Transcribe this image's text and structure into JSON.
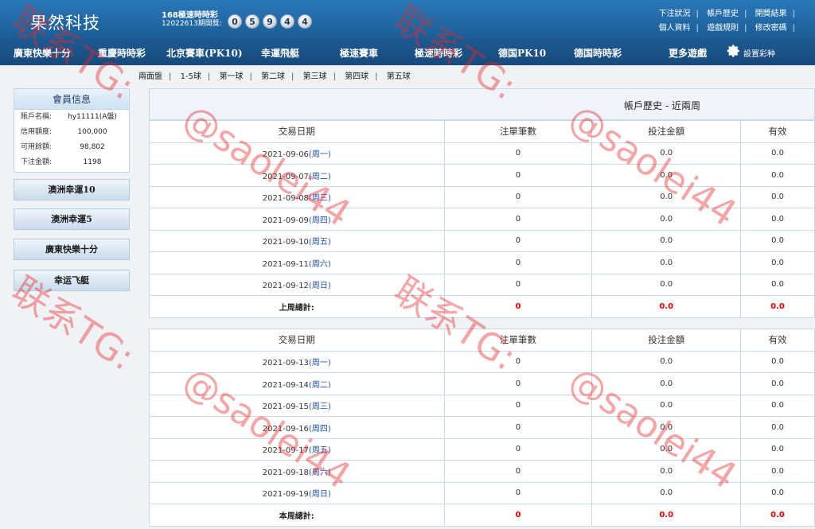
{
  "header": {
    "brand": "果然科技",
    "draw_title": "168極速時時彩",
    "draw_issue": "12022613期開獎:",
    "balls": [
      "0",
      "5",
      "9",
      "4",
      "4"
    ],
    "links_row1": [
      "下注狀況",
      "帳戶歷史",
      "開獎結果"
    ],
    "links_row2": [
      "個人資料",
      "遊戲規則",
      "修改密碼"
    ]
  },
  "nav": {
    "items": [
      "廣東快樂十分",
      "重慶時時彩",
      "北京賽車(PK10)",
      "幸運飛艇",
      "極速賽車",
      "極速時時彩",
      "德国PK10",
      "德国時時彩",
      "更多遊戲"
    ],
    "settings_label": "設置彩种"
  },
  "subnav": [
    "兩面盤",
    "1-5球",
    "第一球",
    "第二球",
    "第三球",
    "第四球",
    "第五球"
  ],
  "member": {
    "title": "會員信息",
    "rows": [
      {
        "key": "賬戶名稱:",
        "value": "hy11111(A盤)"
      },
      {
        "key": "信用額度:",
        "value": "100,000"
      },
      {
        "key": "可用餘額:",
        "value": "98,802"
      },
      {
        "key": "下注金額:",
        "value": "1198"
      }
    ]
  },
  "side_buttons": [
    "澳洲幸運10",
    "澳洲幸運5",
    "廣東快樂十分",
    "幸运飞艇"
  ],
  "panel_title": "帳戶歷史 - 近兩周",
  "table_headers": [
    "交易日期",
    "注單筆數",
    "投注金額",
    "有效"
  ],
  "week1": {
    "rows": [
      {
        "date": "2021-09-06",
        "weekday": "(周一)",
        "count": "0",
        "amount": "0.0",
        "eff": "0.0"
      },
      {
        "date": "2021-09-07",
        "weekday": "(周二)",
        "count": "0",
        "amount": "0.0",
        "eff": "0.0"
      },
      {
        "date": "2021-09-08",
        "weekday": "(周三)",
        "count": "0",
        "amount": "0.0",
        "eff": "0.0"
      },
      {
        "date": "2021-09-09",
        "weekday": "(周四)",
        "count": "0",
        "amount": "0.0",
        "eff": "0.0"
      },
      {
        "date": "2021-09-10",
        "weekday": "(周五)",
        "count": "0",
        "amount": "0.0",
        "eff": "0.0"
      },
      {
        "date": "2021-09-11",
        "weekday": "(周六)",
        "count": "0",
        "amount": "0.0",
        "eff": "0.0"
      },
      {
        "date": "2021-09-12",
        "weekday": "(周日)",
        "count": "0",
        "amount": "0.0",
        "eff": "0.0"
      }
    ],
    "total_label": "上周總計:",
    "total_count": "0",
    "total_amount": "0.0",
    "total_eff": "0.0"
  },
  "week2": {
    "rows": [
      {
        "date": "2021-09-13",
        "weekday": "(周一)",
        "count": "0",
        "amount": "0.0",
        "eff": "0.0"
      },
      {
        "date": "2021-09-14",
        "weekday": "(周二)",
        "count": "0",
        "amount": "0.0",
        "eff": "0.0"
      },
      {
        "date": "2021-09-15",
        "weekday": "(周三)",
        "count": "0",
        "amount": "0.0",
        "eff": "0.0"
      },
      {
        "date": "2021-09-16",
        "weekday": "(周四)",
        "count": "0",
        "amount": "0.0",
        "eff": "0.0"
      },
      {
        "date": "2021-09-17",
        "weekday": "(周五)",
        "count": "0",
        "amount": "0.0",
        "eff": "0.0"
      },
      {
        "date": "2021-09-18",
        "weekday": "(周六)",
        "count": "0",
        "amount": "0.0",
        "eff": "0.0"
      },
      {
        "date": "2021-09-19",
        "weekday": "(周日)",
        "count": "0",
        "amount": "0.0",
        "eff": "0.0"
      }
    ],
    "total_label": "本周總計:",
    "total_count": "0",
    "total_amount": "0.0",
    "total_eff": "0.0"
  },
  "watermark": {
    "line_a": "联系TG:",
    "line_b": "@saolei44"
  },
  "colors": {
    "header_blue": "#1a5e98",
    "nav_blue": "#174a7c",
    "weekday_link": "#1a4fb8",
    "total_red": "#e00000"
  }
}
